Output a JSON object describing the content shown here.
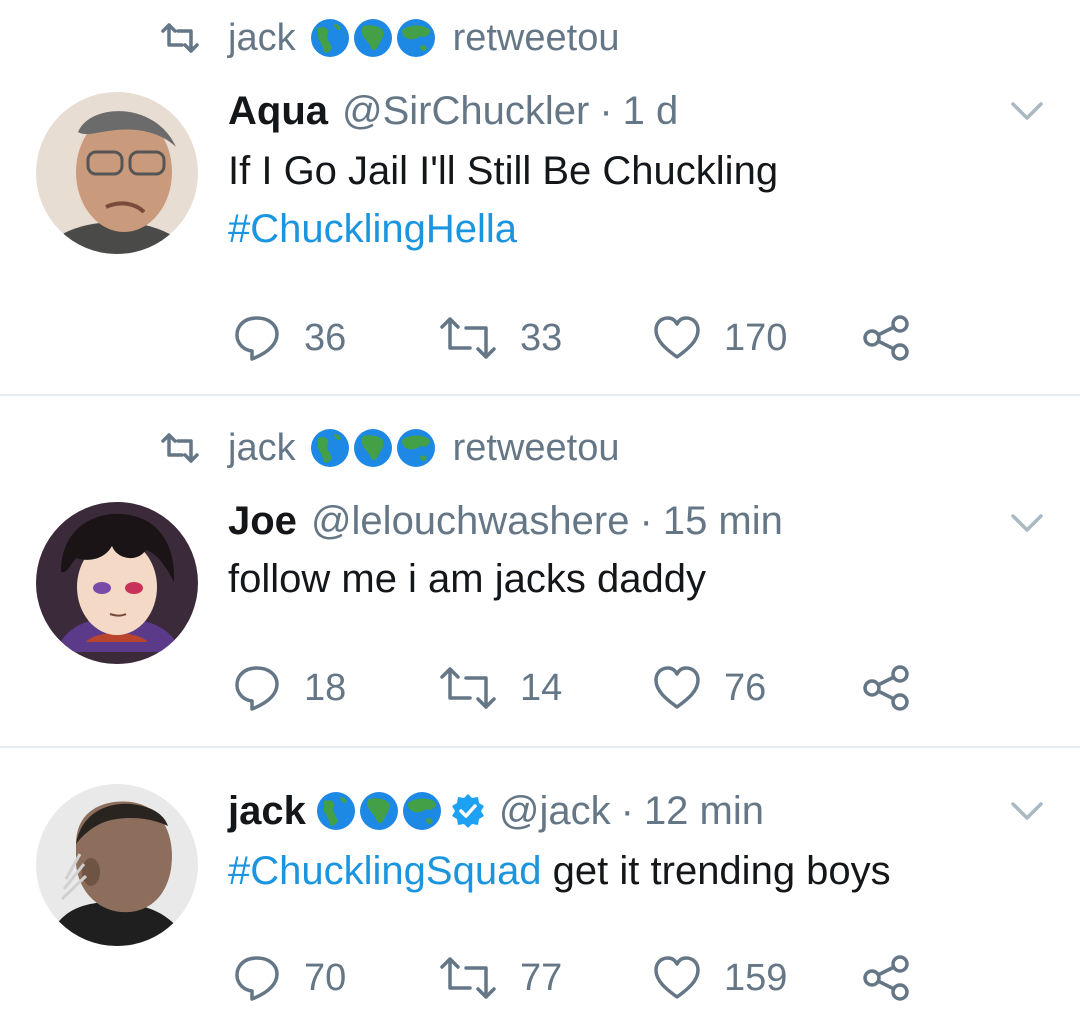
{
  "colors": {
    "muted": "#657786",
    "text": "#14171a",
    "link": "#1b95e0",
    "divider": "#e6ecf0",
    "verified": "#1da1f2"
  },
  "tweets": [
    {
      "retweet": {
        "by": "jack",
        "suffix": "retweetou"
      },
      "name": "Aqua",
      "handle": "@SirChuckler",
      "time": "1 d",
      "text_parts": [
        "If I Go Jail I'll Still Be Chuckling"
      ],
      "hashtag": "#ChucklingHella",
      "replies": "36",
      "retweets": "33",
      "likes": "170"
    },
    {
      "retweet": {
        "by": "jack",
        "suffix": "retweetou"
      },
      "name": "Joe",
      "handle": "@lelouchwashere",
      "time": "15 min",
      "text_parts": [
        "follow me i am jacks daddy"
      ],
      "replies": "18",
      "retweets": "14",
      "likes": "76"
    },
    {
      "name": "jack",
      "handle": "@jack",
      "time": "12 min",
      "hashtag": "#ChucklingSquad",
      "text_after": " get it trending boys",
      "replies": "70",
      "retweets": "77",
      "likes": "159"
    }
  ],
  "separator": "·",
  "icons": [
    "retweet-icon",
    "globe-americas-icon",
    "globe-africa-icon",
    "globe-asia-icon",
    "verified-badge-icon",
    "chevron-down-icon",
    "reply-icon",
    "like-icon",
    "share-icon"
  ]
}
